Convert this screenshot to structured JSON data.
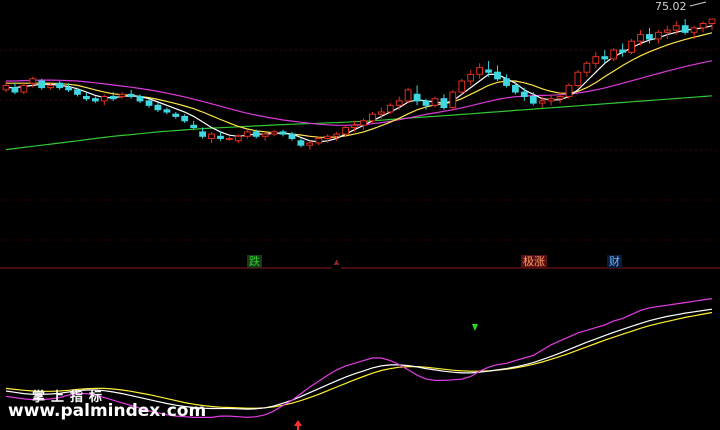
{
  "colors": {
    "background": "#000000",
    "grid": "#3a0000",
    "divider": "#8b1a1a",
    "up": "#e0301e",
    "down": "#3fd6e0",
    "ma_short": "#ffffff",
    "ma_mid": "#ffe34d",
    "ma_long": "#d93bd9",
    "ma_xlong": "#33c733",
    "osc_fast": "#e43be4",
    "osc_mid": "#ffffff",
    "osc_slow": "#ffee33"
  },
  "price_label": "75.02",
  "signals": [
    {
      "text": "跌",
      "name": "signal-label-fall",
      "color": "#33cc33",
      "bg": "#1a3a1a"
    },
    {
      "text": "⩓",
      "name": "signal-marker-up",
      "color": "#ff4444",
      "bg": "#000000"
    },
    {
      "text": "极涨",
      "name": "signal-label-extreme-rise",
      "color": "#ff9966",
      "bg": "#5a1010"
    },
    {
      "text": "财",
      "name": "signal-label-wealth",
      "color": "#66bbff",
      "bg": "#0a1a3a"
    }
  ],
  "watermark": {
    "cn": "掌上指标",
    "url": "www.palmindex.com"
  },
  "chart_data": {
    "type": "candlestick",
    "ylim": [
      0,
      80
    ],
    "candles": [
      [
        43,
        47,
        42,
        45
      ],
      [
        44,
        46,
        41,
        42
      ],
      [
        42,
        46,
        41,
        45
      ],
      [
        46,
        49,
        44,
        48
      ],
      [
        47,
        48,
        43,
        44
      ],
      [
        44,
        46,
        43,
        45
      ],
      [
        46,
        47,
        43,
        44
      ],
      [
        44,
        46,
        42,
        43
      ],
      [
        43,
        44,
        40,
        41
      ],
      [
        40,
        42,
        38,
        39
      ],
      [
        39,
        40,
        37,
        38
      ],
      [
        38,
        41,
        36,
        40
      ],
      [
        40,
        42,
        38,
        39
      ],
      [
        40,
        42,
        39,
        41
      ],
      [
        41,
        43,
        39,
        40
      ],
      [
        40,
        41,
        37,
        38
      ],
      [
        38,
        39,
        35,
        36
      ],
      [
        36,
        37,
        33,
        34
      ],
      [
        34,
        35,
        32,
        33
      ],
      [
        32,
        33,
        30,
        31
      ],
      [
        31,
        32,
        28,
        29
      ],
      [
        27,
        29,
        25,
        26
      ],
      [
        24,
        26,
        21,
        22
      ],
      [
        21,
        24,
        19,
        23
      ],
      [
        22,
        24,
        20,
        21
      ],
      [
        21,
        22,
        20,
        21
      ],
      [
        20,
        23,
        19,
        22
      ],
      [
        22,
        25,
        21,
        24
      ],
      [
        24,
        25,
        21,
        22
      ],
      [
        22,
        24,
        20,
        23
      ],
      [
        23,
        25,
        22,
        24
      ],
      [
        24,
        25,
        22,
        23
      ],
      [
        23,
        24,
        20,
        21
      ],
      [
        20,
        21,
        17,
        18
      ],
      [
        18,
        20,
        16,
        19
      ],
      [
        19,
        22,
        18,
        21
      ],
      [
        21,
        23,
        19,
        22
      ],
      [
        22,
        24,
        20,
        23
      ],
      [
        23,
        27,
        22,
        26
      ],
      [
        26,
        29,
        24,
        27
      ],
      [
        27,
        30,
        25,
        29
      ],
      [
        29,
        33,
        28,
        32
      ],
      [
        32,
        35,
        30,
        33
      ],
      [
        33,
        37,
        32,
        36
      ],
      [
        36,
        40,
        34,
        38
      ],
      [
        38,
        44,
        37,
        43
      ],
      [
        41,
        45,
        36,
        38
      ],
      [
        38,
        39,
        34,
        36
      ],
      [
        36,
        40,
        35,
        39
      ],
      [
        39,
        41,
        34,
        35
      ],
      [
        35,
        43,
        34,
        42
      ],
      [
        42,
        48,
        41,
        47
      ],
      [
        47,
        52,
        45,
        50
      ],
      [
        50,
        55,
        48,
        53
      ],
      [
        52,
        56,
        49,
        51
      ],
      [
        51,
        54,
        47,
        48
      ],
      [
        48,
        50,
        44,
        45
      ],
      [
        45,
        47,
        41,
        42
      ],
      [
        42,
        44,
        38,
        40
      ],
      [
        40,
        42,
        36,
        37
      ],
      [
        37,
        40,
        35,
        38
      ],
      [
        38,
        41,
        36,
        39
      ],
      [
        39,
        42,
        37,
        40
      ],
      [
        40,
        46,
        39,
        45
      ],
      [
        45,
        52,
        44,
        51
      ],
      [
        51,
        56,
        49,
        55
      ],
      [
        55,
        60,
        53,
        58
      ],
      [
        58,
        61,
        55,
        57
      ],
      [
        57,
        62,
        56,
        61
      ],
      [
        61,
        64,
        58,
        60
      ],
      [
        60,
        66,
        59,
        65
      ],
      [
        65,
        70,
        63,
        68
      ],
      [
        68,
        71,
        64,
        66
      ],
      [
        66,
        70,
        64,
        69
      ],
      [
        69,
        72,
        66,
        70
      ],
      [
        70,
        74,
        68,
        72
      ],
      [
        72,
        75,
        68,
        69
      ],
      [
        69,
        72,
        66,
        71
      ],
      [
        71,
        74,
        69,
        73
      ],
      [
        73,
        75,
        70,
        75
      ]
    ],
    "ma_short": [
      44,
      44,
      44.5,
      45,
      45.5,
      45.5,
      45,
      44.5,
      43.5,
      42,
      40.5,
      39.5,
      39.5,
      40,
      40.3,
      40,
      39,
      37.5,
      36,
      34.5,
      33,
      31,
      28.5,
      26,
      24,
      22.5,
      22,
      22.5,
      23,
      23,
      23.3,
      23.5,
      23,
      21.5,
      20,
      19.5,
      20,
      21,
      23,
      25,
      27,
      29,
      31,
      33,
      35,
      37.5,
      38.5,
      38,
      37.5,
      37,
      38,
      41,
      44,
      47,
      50,
      50,
      48,
      46,
      43,
      41,
      39,
      38.5,
      38.5,
      40,
      43,
      47,
      51,
      55,
      58,
      60,
      62,
      64,
      65.5,
      66.5,
      68,
      69,
      70,
      70.5,
      71,
      72
    ],
    "ma_mid": [
      46,
      46,
      46,
      46,
      46,
      46,
      45.8,
      45.5,
      45,
      44,
      43,
      42,
      41.2,
      40.8,
      40.5,
      40,
      39.5,
      38.7,
      37.8,
      36.8,
      35.7,
      34.5,
      33,
      31.3,
      29.6,
      28,
      26.5,
      25.3,
      24.5,
      24,
      23.6,
      23.3,
      23,
      22.6,
      22,
      21.6,
      21.5,
      21.7,
      22.2,
      23,
      24,
      25.3,
      26.8,
      28.4,
      30.2,
      32.2,
      34,
      35.3,
      36.2,
      36.8,
      37.5,
      39,
      41,
      43,
      45,
      46.4,
      47,
      47,
      46.2,
      45,
      43.5,
      42.3,
      41.5,
      41.5,
      42.3,
      44,
      46.3,
      49,
      51.5,
      54,
      56.3,
      58.4,
      60.2,
      61.8,
      63.3,
      64.6,
      65.8,
      66.8,
      67.8,
      68.8
    ],
    "ma_long": [
      47,
      47,
      47.2,
      47.3,
      47.4,
      47.4,
      47.3,
      47.2,
      47,
      46.6,
      46.2,
      45.7,
      45.2,
      44.7,
      44.2,
      43.6,
      43,
      42.3,
      41.5,
      40.7,
      39.8,
      38.8,
      37.8,
      36.7,
      35.6,
      34.5,
      33.4,
      32.4,
      31.6,
      30.8,
      30.1,
      29.4,
      28.9,
      28.4,
      27.9,
      27.5,
      27.2,
      27,
      27,
      27.1,
      27.3,
      27.7,
      28.2,
      28.8,
      29.5,
      30.3,
      31.1,
      31.9,
      32.6,
      33.3,
      34,
      34.9,
      35.8,
      36.8,
      37.8,
      38.7,
      39.4,
      39.9,
      40.2,
      40.4,
      40.5,
      40.6,
      40.8,
      41.1,
      41.6,
      42.2,
      43,
      43.9,
      44.9,
      46,
      47.1,
      48.2,
      49.3,
      50.4,
      51.5,
      52.5,
      53.5,
      54.4,
      55.3,
      56.2
    ],
    "ma_xlong": [
      16,
      16.5,
      17,
      17.5,
      18,
      18.5,
      19,
      19.5,
      20,
      20.5,
      21,
      21.5,
      22,
      22.4,
      22.8,
      23.2,
      23.6,
      24,
      24.3,
      24.6,
      24.9,
      25.2,
      25.5,
      25.7,
      25.9,
      26.1,
      26.3,
      26.5,
      26.7,
      26.9,
      27.1,
      27.3,
      27.5,
      27.6,
      27.8,
      27.9,
      28.1,
      28.2,
      28.4,
      28.6,
      28.8,
      29,
      29.3,
      29.6,
      29.9,
      30.2,
      30.5,
      30.8,
      31,
      31.3,
      31.6,
      31.9,
      32.2,
      32.5,
      32.8,
      33.1,
      33.4,
      33.7,
      34,
      34.3,
      34.6,
      34.9,
      35.2,
      35.5,
      35.8,
      36.1,
      36.4,
      36.7,
      37,
      37.3,
      37.6,
      37.9,
      38.2,
      38.5,
      38.8,
      39.1,
      39.4,
      39.7,
      40,
      40.3
    ],
    "osc_fast": [
      42,
      40,
      38,
      37,
      37,
      38,
      40,
      44,
      46,
      46,
      44,
      40,
      36,
      32,
      28,
      24,
      20,
      17,
      14,
      12,
      11,
      10,
      10,
      10,
      12,
      12,
      11,
      10,
      11,
      14,
      20,
      28,
      36,
      46,
      56,
      65,
      74,
      82,
      88,
      92,
      96,
      100,
      100,
      96,
      90,
      82,
      74,
      68,
      66,
      66,
      67,
      68,
      72,
      80,
      86,
      90,
      92,
      96,
      100,
      104,
      112,
      120,
      126,
      132,
      138,
      142,
      146,
      150,
      156,
      160,
      166,
      172,
      176,
      178,
      180,
      182,
      184,
      186,
      188,
      190
    ],
    "osc_mid": [
      50,
      48,
      46,
      45,
      45,
      45.5,
      46.5,
      48.5,
      50.5,
      51.5,
      51.5,
      50.5,
      48.5,
      46,
      43,
      40,
      37,
      34,
      31,
      28.5,
      26.5,
      25,
      24,
      23.5,
      23.5,
      23.5,
      23,
      22.5,
      23,
      24.5,
      27.5,
      31.5,
      36,
      41.5,
      47.5,
      53.5,
      59.5,
      65.5,
      71,
      76,
      80.5,
      85,
      88,
      89.5,
      89.5,
      88.5,
      86.5,
      84,
      82,
      80,
      78.5,
      77.5,
      77.5,
      78.5,
      80,
      82,
      84,
      86.5,
      89.5,
      93,
      97.5,
      102.5,
      107.5,
      113,
      118.5,
      124,
      129,
      134,
      139,
      143.5,
      148,
      152.5,
      156.5,
      160,
      163,
      165.5,
      168,
      170,
      172,
      174
    ],
    "osc_slow": [
      54,
      52.5,
      51,
      50,
      49.5,
      49.5,
      50,
      51,
      52.5,
      53.5,
      54,
      54,
      53,
      51.5,
      49.5,
      47,
      44.5,
      41.5,
      38.5,
      35.5,
      32.5,
      30,
      28,
      26.5,
      25.5,
      25,
      24.5,
      24,
      24,
      24.5,
      26,
      28.5,
      31.5,
      35.5,
      40,
      45,
      50.5,
      56,
      61.5,
      67,
      72,
      77,
      81,
      84,
      86,
      87,
      87,
      86,
      84.5,
      83,
      81.5,
      80.5,
      80,
      80,
      80.5,
      81.5,
      83,
      85,
      87.5,
      90.5,
      94,
      98,
      102.5,
      107,
      112,
      117,
      122,
      127,
      131.5,
      136,
      140.5,
      145,
      149,
      152.5,
      155.5,
      158.5,
      161.5,
      164,
      166.5,
      169
    ]
  }
}
